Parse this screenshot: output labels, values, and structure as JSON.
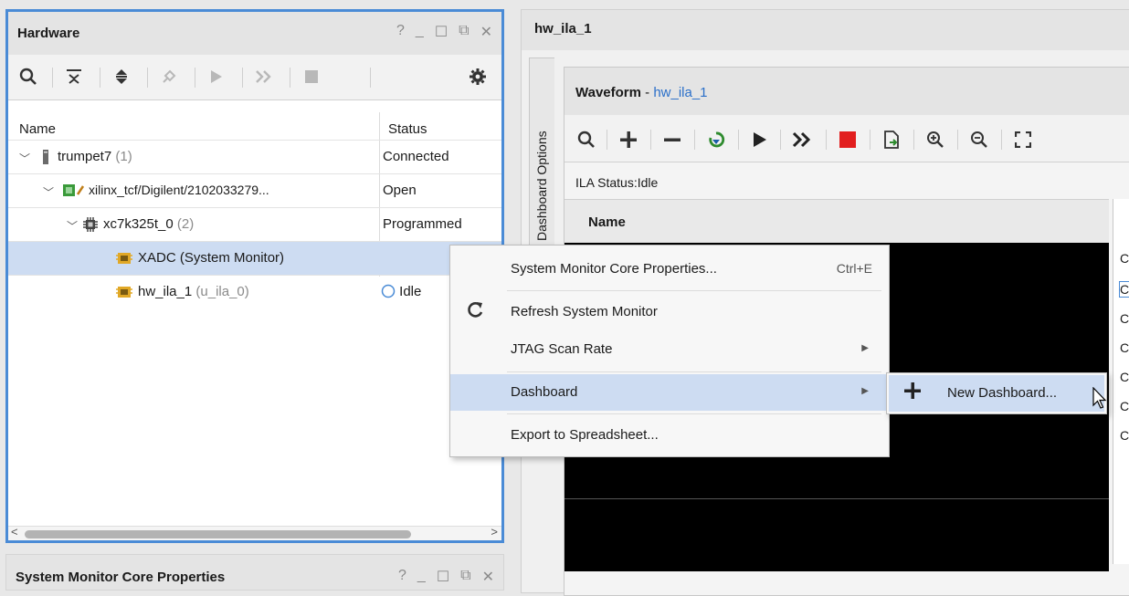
{
  "hardware_panel": {
    "title": "Hardware",
    "controls": [
      "?",
      "_",
      "☐",
      "⧉",
      "✕"
    ],
    "columns": {
      "name": "Name",
      "status": "Status"
    },
    "rows": [
      {
        "label": "trumpet7",
        "count": "(1)",
        "status": "Connected"
      },
      {
        "label": "xilinx_tcf/Digilent/2102033279...",
        "count": "",
        "status": "Open"
      },
      {
        "label": "xc7k325t_0",
        "count": "(2)",
        "status": "Programmed"
      },
      {
        "label": "XADC (System Monitor)",
        "count": "",
        "status": ""
      },
      {
        "label": "hw_ila_1",
        "count": "(u_ila_0)",
        "status": "Idle"
      }
    ],
    "scroll_left": "<",
    "scroll_right": ">"
  },
  "bottom_panel": {
    "title": "System Monitor Core Properties",
    "controls": [
      "?",
      "_",
      "☐",
      "⧉",
      "✕"
    ]
  },
  "ila_panel": {
    "title": "hw_ila_1",
    "side_tab": "Dashboard Options",
    "waveform_title_bold": "Waveform",
    "waveform_title_sep": " - ",
    "waveform_title_link": "hw_ila_1",
    "ila_status": "ILA Status:Idle",
    "name_header": "Name",
    "right_values": [
      "C",
      "C",
      "C",
      "C",
      "C",
      "C",
      "C"
    ]
  },
  "context_menu": {
    "items": [
      {
        "label": "System Monitor Core Properties...",
        "accelerator": "Ctrl+E"
      },
      {
        "label": "Refresh System Monitor",
        "icon": "refresh-icon"
      },
      {
        "label": "JTAG Scan Rate",
        "submenu": true
      },
      {
        "label": "Dashboard",
        "submenu": true,
        "highlighted": true
      },
      {
        "label": "Export to Spreadsheet..."
      }
    ]
  },
  "submenu": {
    "label": "New Dashboard...",
    "icon": "plus-icon"
  },
  "colors": {
    "focus_border": "#4a8bd6",
    "highlight": "#cddcf2",
    "link": "#2a6fc9",
    "stop": "#e21e1e"
  }
}
